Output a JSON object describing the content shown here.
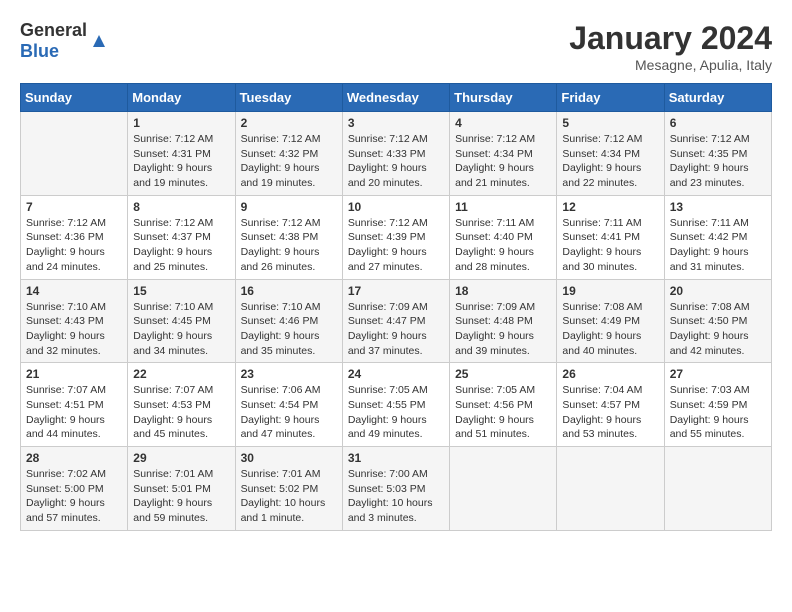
{
  "header": {
    "logo_general": "General",
    "logo_blue": "Blue",
    "month_year": "January 2024",
    "location": "Mesagne, Apulia, Italy"
  },
  "days_of_week": [
    "Sunday",
    "Monday",
    "Tuesday",
    "Wednesday",
    "Thursday",
    "Friday",
    "Saturday"
  ],
  "weeks": [
    [
      {
        "day": "",
        "content": ""
      },
      {
        "day": "1",
        "content": "Sunrise: 7:12 AM\nSunset: 4:31 PM\nDaylight: 9 hours\nand 19 minutes."
      },
      {
        "day": "2",
        "content": "Sunrise: 7:12 AM\nSunset: 4:32 PM\nDaylight: 9 hours\nand 19 minutes."
      },
      {
        "day": "3",
        "content": "Sunrise: 7:12 AM\nSunset: 4:33 PM\nDaylight: 9 hours\nand 20 minutes."
      },
      {
        "day": "4",
        "content": "Sunrise: 7:12 AM\nSunset: 4:34 PM\nDaylight: 9 hours\nand 21 minutes."
      },
      {
        "day": "5",
        "content": "Sunrise: 7:12 AM\nSunset: 4:34 PM\nDaylight: 9 hours\nand 22 minutes."
      },
      {
        "day": "6",
        "content": "Sunrise: 7:12 AM\nSunset: 4:35 PM\nDaylight: 9 hours\nand 23 minutes."
      }
    ],
    [
      {
        "day": "7",
        "content": "Sunrise: 7:12 AM\nSunset: 4:36 PM\nDaylight: 9 hours\nand 24 minutes."
      },
      {
        "day": "8",
        "content": "Sunrise: 7:12 AM\nSunset: 4:37 PM\nDaylight: 9 hours\nand 25 minutes."
      },
      {
        "day": "9",
        "content": "Sunrise: 7:12 AM\nSunset: 4:38 PM\nDaylight: 9 hours\nand 26 minutes."
      },
      {
        "day": "10",
        "content": "Sunrise: 7:12 AM\nSunset: 4:39 PM\nDaylight: 9 hours\nand 27 minutes."
      },
      {
        "day": "11",
        "content": "Sunrise: 7:11 AM\nSunset: 4:40 PM\nDaylight: 9 hours\nand 28 minutes."
      },
      {
        "day": "12",
        "content": "Sunrise: 7:11 AM\nSunset: 4:41 PM\nDaylight: 9 hours\nand 30 minutes."
      },
      {
        "day": "13",
        "content": "Sunrise: 7:11 AM\nSunset: 4:42 PM\nDaylight: 9 hours\nand 31 minutes."
      }
    ],
    [
      {
        "day": "14",
        "content": "Sunrise: 7:10 AM\nSunset: 4:43 PM\nDaylight: 9 hours\nand 32 minutes."
      },
      {
        "day": "15",
        "content": "Sunrise: 7:10 AM\nSunset: 4:45 PM\nDaylight: 9 hours\nand 34 minutes."
      },
      {
        "day": "16",
        "content": "Sunrise: 7:10 AM\nSunset: 4:46 PM\nDaylight: 9 hours\nand 35 minutes."
      },
      {
        "day": "17",
        "content": "Sunrise: 7:09 AM\nSunset: 4:47 PM\nDaylight: 9 hours\nand 37 minutes."
      },
      {
        "day": "18",
        "content": "Sunrise: 7:09 AM\nSunset: 4:48 PM\nDaylight: 9 hours\nand 39 minutes."
      },
      {
        "day": "19",
        "content": "Sunrise: 7:08 AM\nSunset: 4:49 PM\nDaylight: 9 hours\nand 40 minutes."
      },
      {
        "day": "20",
        "content": "Sunrise: 7:08 AM\nSunset: 4:50 PM\nDaylight: 9 hours\nand 42 minutes."
      }
    ],
    [
      {
        "day": "21",
        "content": "Sunrise: 7:07 AM\nSunset: 4:51 PM\nDaylight: 9 hours\nand 44 minutes."
      },
      {
        "day": "22",
        "content": "Sunrise: 7:07 AM\nSunset: 4:53 PM\nDaylight: 9 hours\nand 45 minutes."
      },
      {
        "day": "23",
        "content": "Sunrise: 7:06 AM\nSunset: 4:54 PM\nDaylight: 9 hours\nand 47 minutes."
      },
      {
        "day": "24",
        "content": "Sunrise: 7:05 AM\nSunset: 4:55 PM\nDaylight: 9 hours\nand 49 minutes."
      },
      {
        "day": "25",
        "content": "Sunrise: 7:05 AM\nSunset: 4:56 PM\nDaylight: 9 hours\nand 51 minutes."
      },
      {
        "day": "26",
        "content": "Sunrise: 7:04 AM\nSunset: 4:57 PM\nDaylight: 9 hours\nand 53 minutes."
      },
      {
        "day": "27",
        "content": "Sunrise: 7:03 AM\nSunset: 4:59 PM\nDaylight: 9 hours\nand 55 minutes."
      }
    ],
    [
      {
        "day": "28",
        "content": "Sunrise: 7:02 AM\nSunset: 5:00 PM\nDaylight: 9 hours\nand 57 minutes."
      },
      {
        "day": "29",
        "content": "Sunrise: 7:01 AM\nSunset: 5:01 PM\nDaylight: 9 hours\nand 59 minutes."
      },
      {
        "day": "30",
        "content": "Sunrise: 7:01 AM\nSunset: 5:02 PM\nDaylight: 10 hours\nand 1 minute."
      },
      {
        "day": "31",
        "content": "Sunrise: 7:00 AM\nSunset: 5:03 PM\nDaylight: 10 hours\nand 3 minutes."
      },
      {
        "day": "",
        "content": ""
      },
      {
        "day": "",
        "content": ""
      },
      {
        "day": "",
        "content": ""
      }
    ]
  ]
}
